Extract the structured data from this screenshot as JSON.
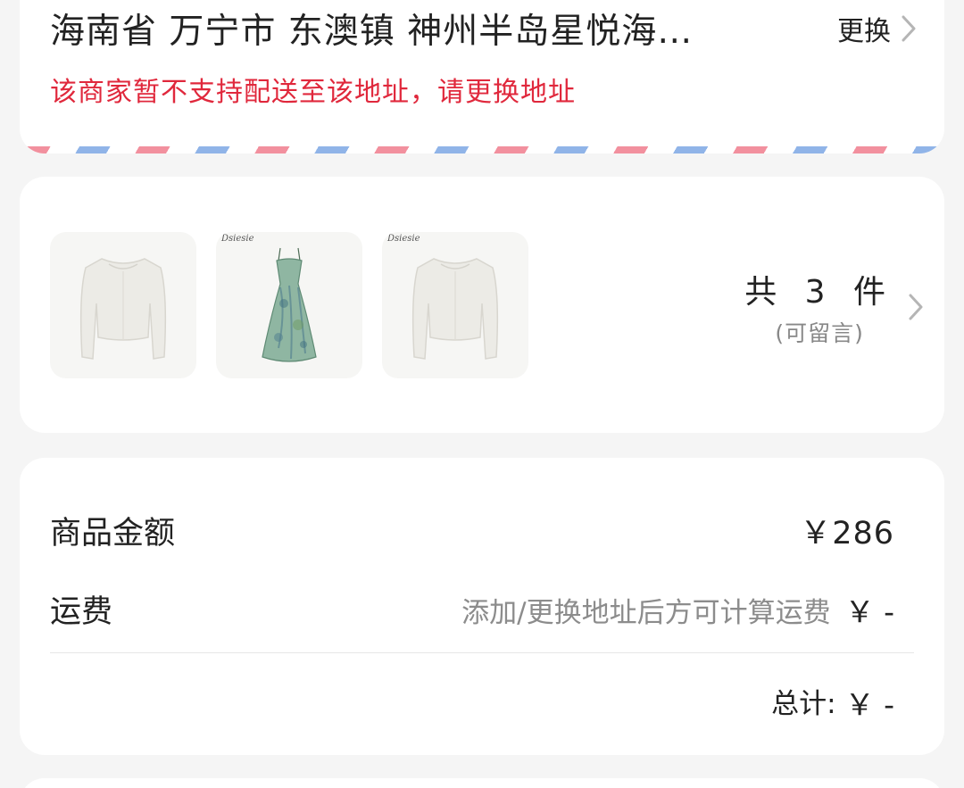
{
  "address": {
    "line": "海南省 万宁市 东澳镇 神州半岛星悦海…",
    "change_label": "更换",
    "warning": "该商家暂不支持配送至该地址，请更换地址"
  },
  "items": {
    "thumbnails": [
      {
        "kind": "white cropped cardigan",
        "brand": ""
      },
      {
        "kind": "green floral slip dress",
        "brand": "Dsiesie"
      },
      {
        "kind": "white cropped cardigan",
        "brand": "Dsiesie"
      }
    ],
    "count_label": "共 3 件",
    "note_label": "(可留言)"
  },
  "price": {
    "goods_label": "商品金额",
    "goods_value": "￥286",
    "shipping_label": "运费",
    "shipping_hint": "添加/更换地址后方可计算运费",
    "shipping_value": "￥ -",
    "total_label": "总计:",
    "total_value": "￥ -"
  },
  "colors": {
    "warning": "#e0283c",
    "airmail_red": "#f2909e",
    "airmail_blue": "#90b4e8"
  }
}
